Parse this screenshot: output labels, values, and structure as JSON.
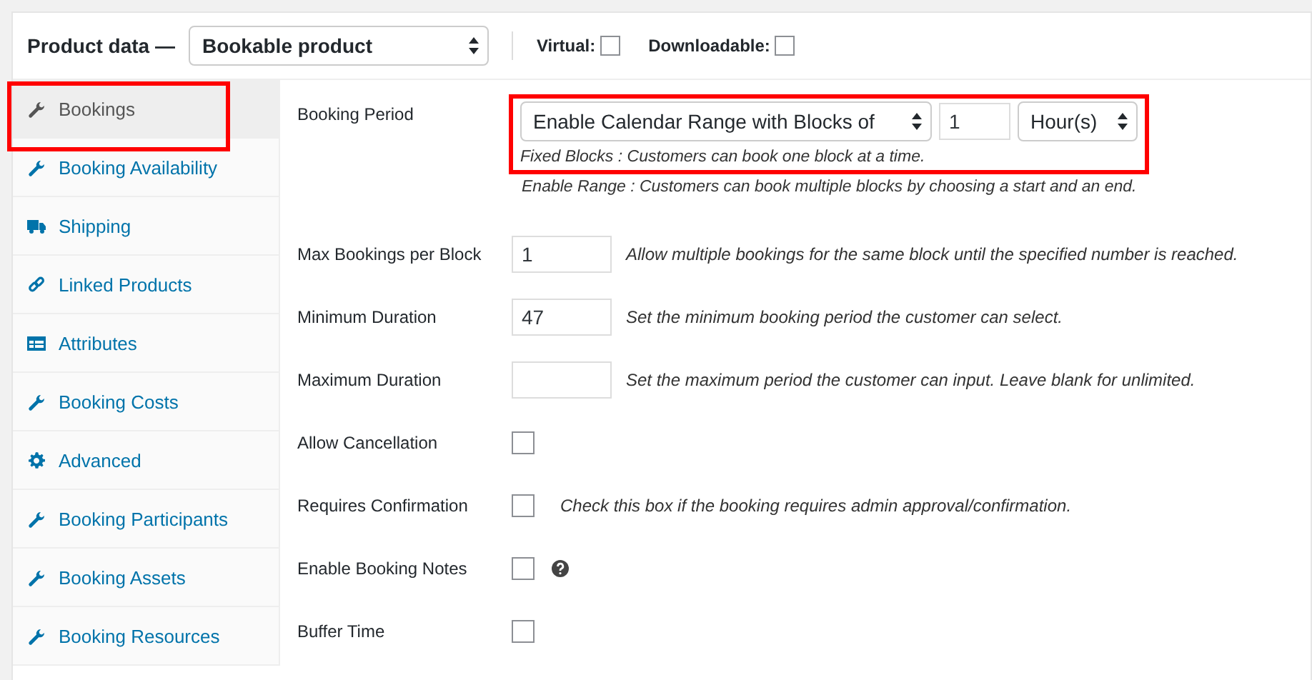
{
  "header": {
    "title": "Product data —",
    "product_type": "Bookable product",
    "options": [
      {
        "label": "Virtual:",
        "checked": false
      },
      {
        "label": "Downloadable:",
        "checked": false
      }
    ]
  },
  "tabs": [
    {
      "label": "Bookings",
      "kind": "wrench",
      "selected": true,
      "highlighted": true
    },
    {
      "label": "Booking Availability",
      "kind": "wrench",
      "selected": false,
      "highlighted": false
    },
    {
      "label": "Shipping",
      "kind": "truck",
      "selected": false,
      "highlighted": false
    },
    {
      "label": "Linked Products",
      "kind": "link",
      "selected": false,
      "highlighted": false
    },
    {
      "label": "Attributes",
      "kind": "list",
      "selected": false,
      "highlighted": false
    },
    {
      "label": "Booking Costs",
      "kind": "wrench",
      "selected": false,
      "highlighted": false
    },
    {
      "label": "Advanced",
      "kind": "gear",
      "selected": false,
      "highlighted": false
    },
    {
      "label": "Booking Participants",
      "kind": "wrench",
      "selected": false,
      "highlighted": false
    },
    {
      "label": "Booking Assets",
      "kind": "wrench",
      "selected": false,
      "highlighted": false
    },
    {
      "label": "Booking Resources",
      "kind": "wrench",
      "selected": false,
      "highlighted": false
    }
  ],
  "booking_period": {
    "label": "Booking Period",
    "mode": "Enable Calendar Range with Blocks of",
    "count": "1",
    "unit": "Hour(s)",
    "highlighted": true,
    "notes": [
      "Fixed Blocks : Customers can book one block at a time.",
      "Enable Range : Customers can book multiple blocks by choosing a start and an end."
    ]
  },
  "fields": [
    {
      "kind": "number",
      "label": "Max Bookings per Block",
      "value": "1",
      "description": "Allow multiple bookings for the same block until the specified number is reached."
    },
    {
      "kind": "number",
      "label": "Minimum Duration",
      "value": "47",
      "description": "Set the minimum booking period the customer can select."
    },
    {
      "kind": "number",
      "label": "Maximum Duration",
      "description": "Set the maximum period the customer can input. Leave blank for unlimited."
    },
    {
      "kind": "checkbox",
      "label": "Allow Cancellation",
      "checked": false
    },
    {
      "kind": "checkbox",
      "label": "Requires Confirmation",
      "checked": false,
      "description": "Check this box if the booking requires admin approval/confirmation."
    },
    {
      "kind": "checkbox",
      "label": "Enable Booking Notes",
      "checked": false,
      "help": true
    },
    {
      "kind": "checkbox",
      "label": "Buffer Time",
      "checked": false
    }
  ]
}
